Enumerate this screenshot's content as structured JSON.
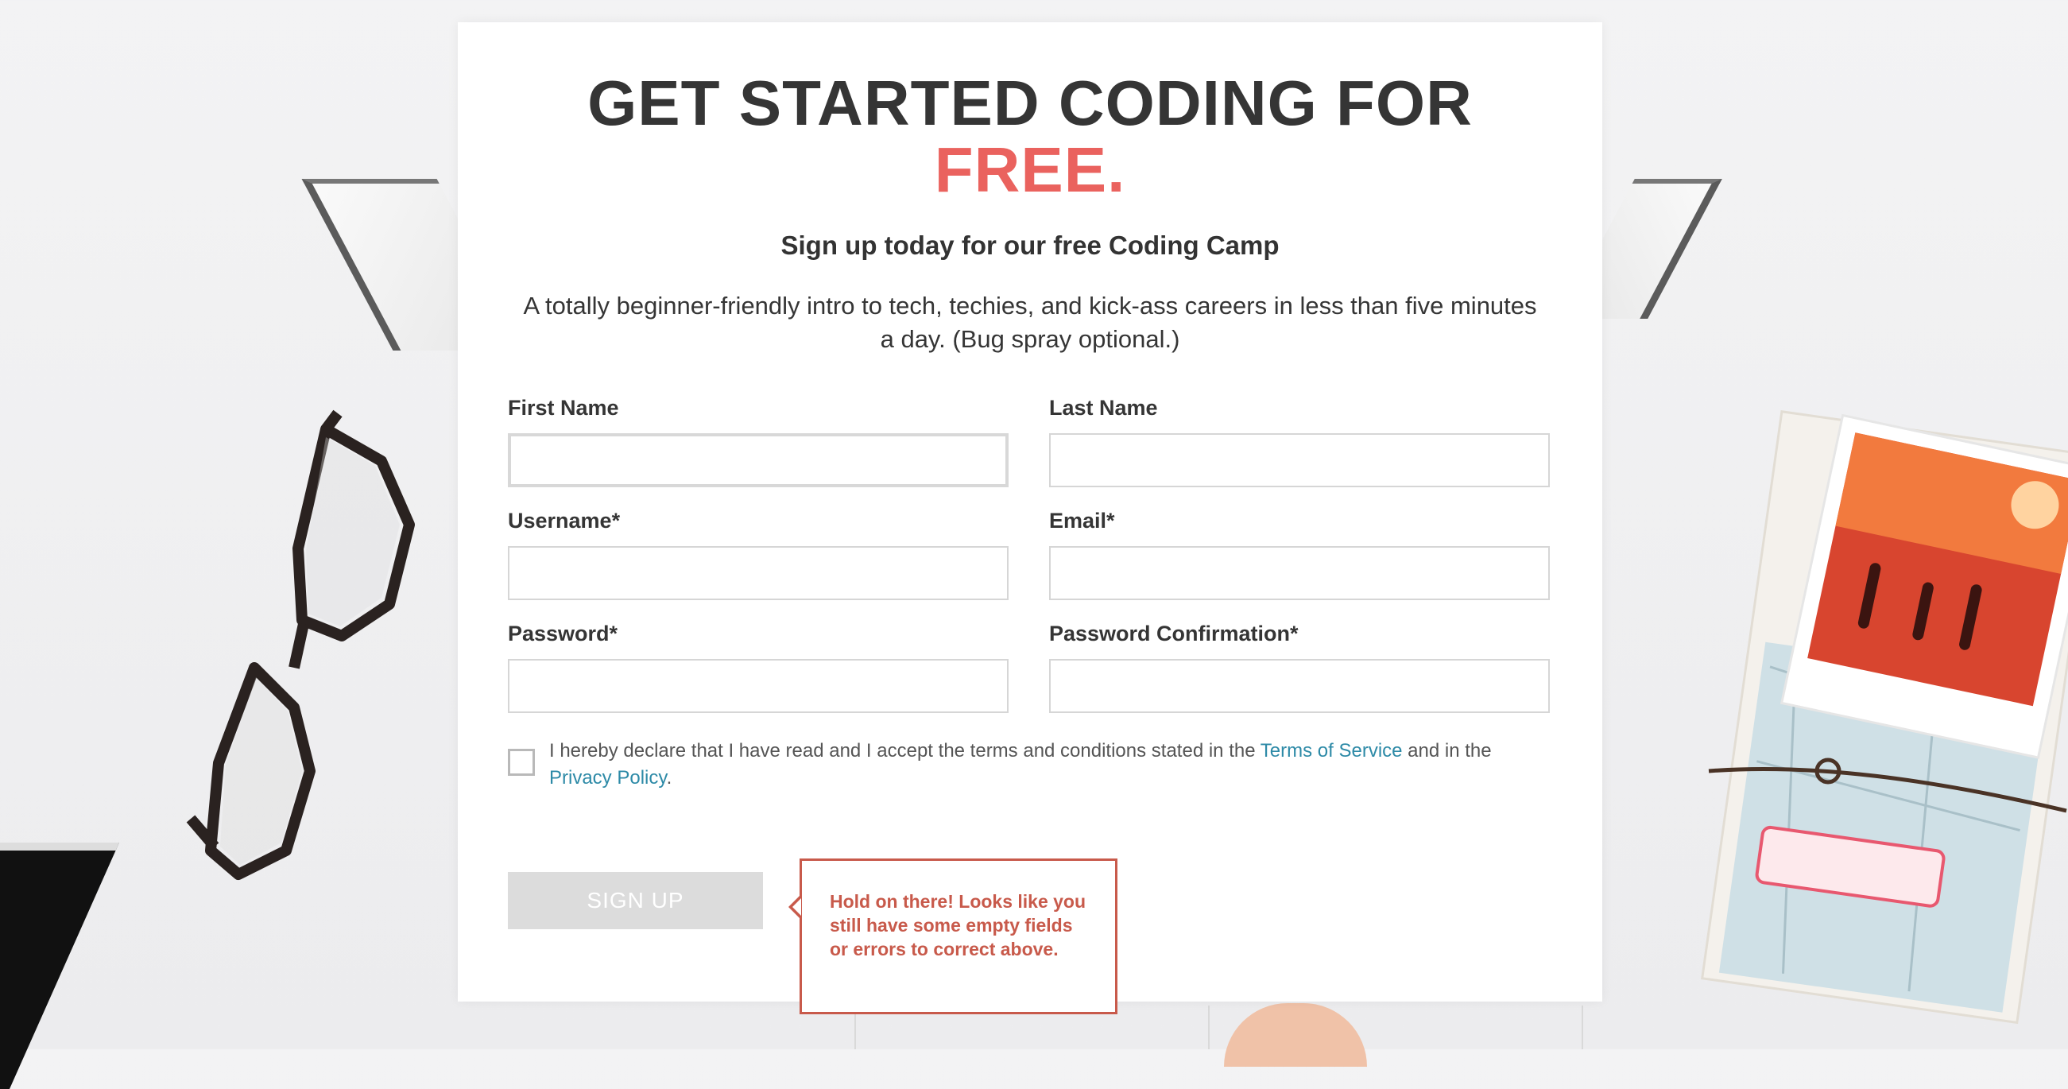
{
  "header": {
    "title_line1": "GET STARTED CODING FOR",
    "title_line2": "FREE.",
    "subtitle": "Sign up today for our free Coding Camp",
    "description": "A totally beginner-friendly intro to tech, techies, and kick-ass careers in less than five minutes a day. (Bug spray optional.)"
  },
  "form": {
    "first_name": {
      "label": "First Name",
      "value": ""
    },
    "last_name": {
      "label": "Last Name",
      "value": ""
    },
    "username": {
      "label": "Username*",
      "value": ""
    },
    "email": {
      "label": "Email*",
      "value": ""
    },
    "password": {
      "label": "Password*",
      "value": ""
    },
    "password_confirmation": {
      "label": "Password Confirmation*",
      "value": ""
    }
  },
  "agreement": {
    "text_before": "I hereby declare that I have read and I accept the terms and conditions stated in the ",
    "terms_link": "Terms of Service",
    "text_middle": " and in the ",
    "privacy_link": "Privacy Policy",
    "text_after": ".",
    "checked": false
  },
  "actions": {
    "signup_label": "SIGN UP"
  },
  "tooltip": {
    "message": "Hold on there! Looks like you still have some empty fields or errors to correct above."
  },
  "colors": {
    "accent": "#ea625e",
    "error": "#c85a4b",
    "link": "#2d8aa7",
    "button_disabled": "#dcdcdc"
  }
}
